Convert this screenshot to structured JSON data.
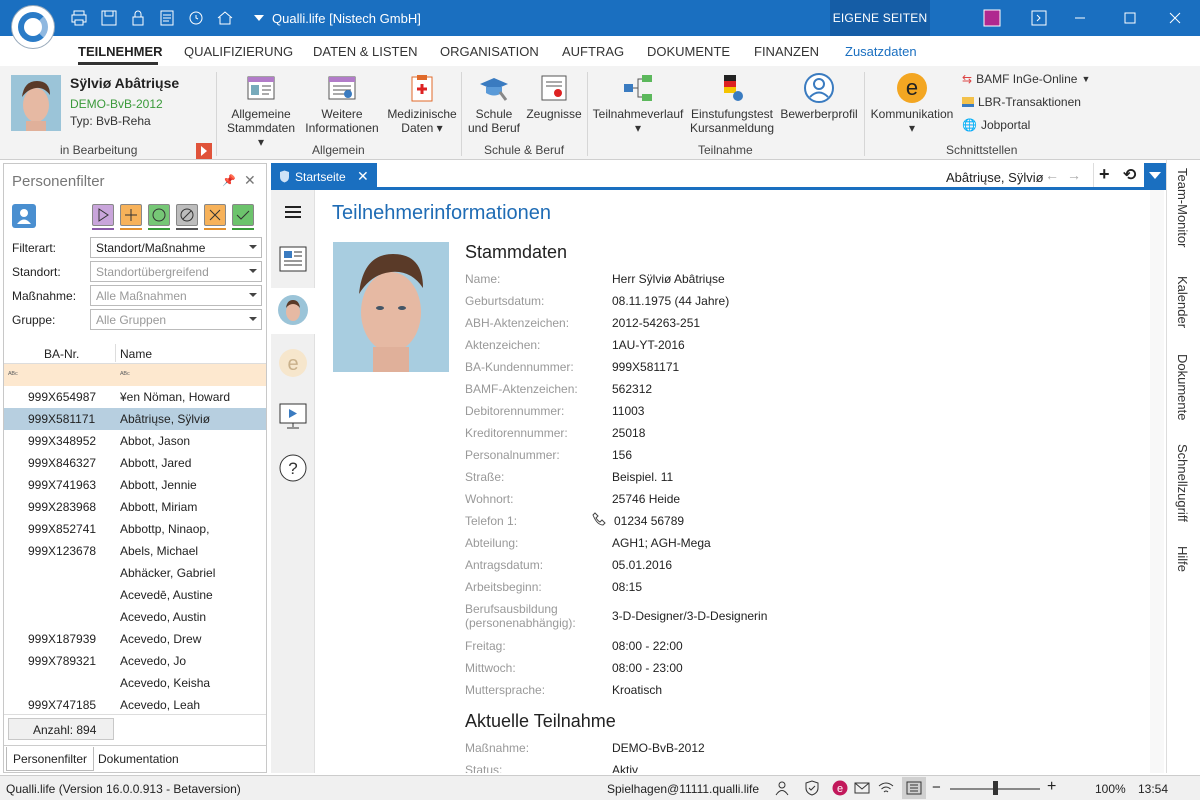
{
  "window": {
    "title": "Qualli.life [Nistech GmbH]",
    "eigene": "EIGENE SEITEN"
  },
  "menu": {
    "items": [
      "TEILNEHMER",
      "QUALIFIZIERUNG",
      "DATEN & LISTEN",
      "ORGANISATION",
      "AUFTRAG",
      "DOKUMENTE",
      "FINANZEN",
      "Zusatzdaten"
    ]
  },
  "user": {
    "name": "Sÿlviø Abâtriųse",
    "program": "DEMO-BvB-2012",
    "type": "Typ: BvB-Reha",
    "status": "in Bearbeitung"
  },
  "ribbon": {
    "allgemeine": "Allgemeine",
    "stammdaten": "Stammdaten",
    "weitere": "Weitere",
    "informationen": "Informationen",
    "medizinische": "Medizinische",
    "daten": "Daten",
    "grp_allgemein": "Allgemein",
    "schule": "Schule",
    "und_beruf": "und Beruf",
    "zeugnisse": "Zeugnisse",
    "grp_schule": "Schule & Beruf",
    "teilnahmeverlauf": "Teilnahmeverlauf",
    "einstufungstest": "Einstufungstest",
    "kursanmeldung": "Kursanmeldung",
    "bewerberprofil": "Bewerberprofil",
    "grp_teilnahme": "Teilnahme",
    "kommunikation": "Kommunikation",
    "bamf": "BAMF InGe-Online",
    "lbr": "LBR-Transaktionen",
    "jobportal": "Jobportal",
    "grp_schnitt": "Schnittstellen"
  },
  "filter": {
    "title": "Personenfilter",
    "filterart_label": "Filterart:",
    "filterart": "Standort/Maßnahme",
    "standort_label": "Standort:",
    "standort": "Standortübergreifend",
    "massnahme_label": "Maßnahme:",
    "massnahme": "Alle Maßnahmen",
    "gruppe_label": "Gruppe:",
    "gruppe": "Alle Gruppen",
    "col1": "BA-Nr.",
    "col2": "Name",
    "rows": [
      {
        "ba": "999X654987",
        "name": "¥en Nöman, Howard"
      },
      {
        "ba": "999X581171",
        "name": "Abâtriųse, Sÿlviø"
      },
      {
        "ba": "999X348952",
        "name": "Abbot, Jason"
      },
      {
        "ba": "999X846327",
        "name": "Abbott, Jared"
      },
      {
        "ba": "999X741963",
        "name": "Abbott, Jennie"
      },
      {
        "ba": "999X283968",
        "name": "Abbott, Miriam"
      },
      {
        "ba": "999X852741",
        "name": "Abbottp, Ninaop,"
      },
      {
        "ba": "999X123678",
        "name": "Abels, Michael"
      },
      {
        "ba": "",
        "name": "Abhäcker, Gabriel"
      },
      {
        "ba": "",
        "name": "Acevedē, Austine"
      },
      {
        "ba": "",
        "name": "Acevedo, Austin"
      },
      {
        "ba": "999X187939",
        "name": "Acevedo, Drew"
      },
      {
        "ba": "999X789321",
        "name": "Acevedo, Jo"
      },
      {
        "ba": "",
        "name": "Acevedo, Keisha"
      },
      {
        "ba": "999X747185",
        "name": "Acevedo, Leah"
      }
    ],
    "count": "Anzahl: 894",
    "tab1": "Personenfilter",
    "tab2": "Dokumentation"
  },
  "doc": {
    "tab": "Startseite",
    "header_name": "Abâtriųse, Sÿlviø",
    "heading": "Teilnehmerinformationen",
    "stammdaten": "Stammdaten",
    "fields": [
      {
        "l": "Name:",
        "v": "Herr Sÿlviø Abâtriųse"
      },
      {
        "l": "Geburtsdatum:",
        "v": "08.11.1975 (44 Jahre)"
      },
      {
        "l": "ABH-Aktenzeichen:",
        "v": "2012-54263-251"
      },
      {
        "l": "Aktenzeichen:",
        "v": "1AU-YT-2016"
      },
      {
        "l": "BA-Kundennummer:",
        "v": "999X581171"
      },
      {
        "l": "BAMF-Aktenzeichen:",
        "v": "562312"
      },
      {
        "l": "Debitorennummer:",
        "v": "11003"
      },
      {
        "l": "Kreditorennummer:",
        "v": "25018"
      },
      {
        "l": "Personalnummer:",
        "v": "156"
      },
      {
        "l": "Straße:",
        "v": "Beispiel. 11"
      },
      {
        "l": "Wohnort:",
        "v": "25746 Heide"
      },
      {
        "l": "Telefon 1:",
        "v": "01234 56789"
      },
      {
        "l": "Abteilung:",
        "v": "AGH1; AGH-Mega"
      },
      {
        "l": "Antragsdatum:",
        "v": "05.01.2016"
      },
      {
        "l": "Arbeitsbeginn:",
        "v": "08:15"
      }
    ],
    "beruf_l1": "Berufsausbildung",
    "beruf_l2": "(personenabhängig):",
    "beruf_v": "3-D-Designer/3-D-Designerin",
    "fields2": [
      {
        "l": "Freitag:",
        "v": "08:00 - 22:00"
      },
      {
        "l": "Mittwoch:",
        "v": "08:00 - 23:00"
      },
      {
        "l": "Muttersprache:",
        "v": "Kroatisch"
      }
    ],
    "aktuelle": "Aktuelle Teilnahme",
    "fields3": [
      {
        "l": "Maßnahme:",
        "v": "DEMO-BvB-2012"
      },
      {
        "l": "Status:",
        "v": "Aktiv"
      }
    ]
  },
  "rightbar": [
    "Team-Monitor",
    "Kalender",
    "Dokumente",
    "Schnellzugriff",
    "Hilfe"
  ],
  "status": {
    "version": "Qualli.life (Version 16.0.0.913 - Betaversion)",
    "user": "Spielhagen@11111.qualli.life",
    "zoom": "100%",
    "time": "13:54"
  },
  "colors": {
    "accent": "#1a6fc0"
  }
}
